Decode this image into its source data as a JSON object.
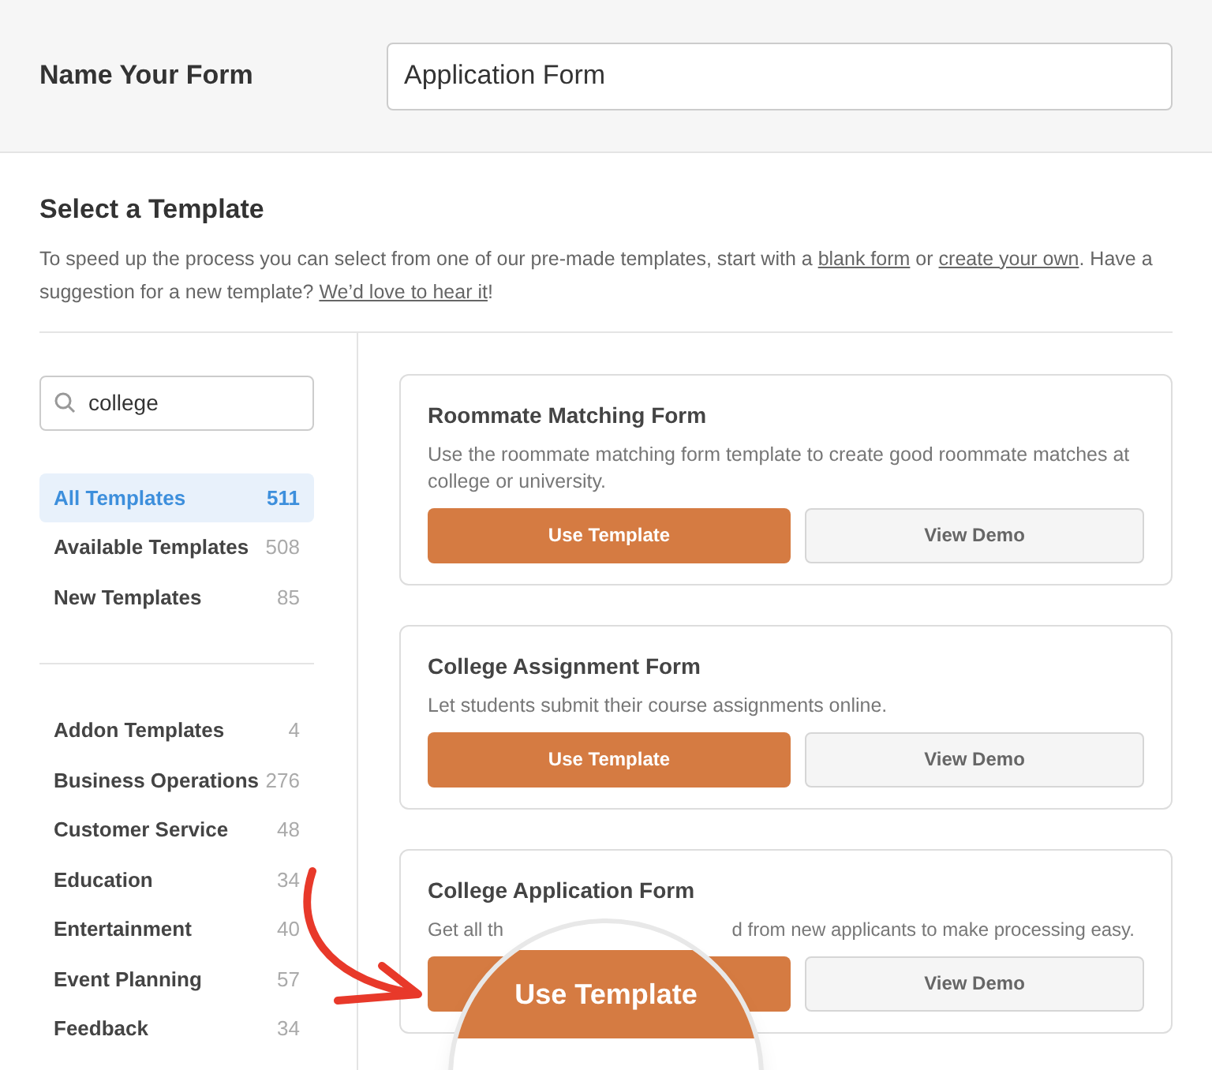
{
  "name_form": {
    "label": "Name Your Form",
    "value": "Application Form"
  },
  "intro": {
    "title": "Select a Template",
    "text_before": "To speed up the process you can select from one of our pre-made templates, start with a",
    "link_1": "blank form",
    "text_middle": "or",
    "link_2": "create your own",
    "text_after": ". Have a suggestion for a new template?",
    "link_3": "We’d love to hear it",
    "text_end": "!"
  },
  "search": {
    "value": "college"
  },
  "filters": [
    {
      "label": "All Templates",
      "count": "511",
      "selected": true
    },
    {
      "label": "Available Templates",
      "count": "508",
      "selected": false
    },
    {
      "label": "New Templates",
      "count": "85",
      "selected": false
    }
  ],
  "categories": [
    {
      "label": "Addon Templates",
      "count": "4",
      "selected": false
    },
    {
      "label": "Business Operations",
      "count": "276",
      "selected": false
    },
    {
      "label": "Customer Service",
      "count": "48",
      "selected": false
    },
    {
      "label": "Education",
      "count": "34",
      "selected": false
    },
    {
      "label": "Entertainment",
      "count": "40",
      "selected": false
    },
    {
      "label": "Event Planning",
      "count": "57",
      "selected": false
    },
    {
      "label": "Feedback",
      "count": "34",
      "selected": false
    }
  ],
  "templates": [
    {
      "title": "Roommate Matching Form",
      "description": [
        "Use the roommate matching form template to create good roommate matches at college or university."
      ],
      "primary": "Use Template",
      "secondary": "View Demo"
    },
    {
      "title": "College Assignment Form",
      "description": [
        "Let students submit their course assignments online."
      ],
      "primary": "Use Template",
      "secondary": "View Demo"
    },
    {
      "title": "College Application Form",
      "description": [
        "Get all th",
        "d from new applicants to make processing easy."
      ],
      "secondary": "View Demo"
    }
  ],
  "magnifier": {
    "label": "Use Template"
  }
}
